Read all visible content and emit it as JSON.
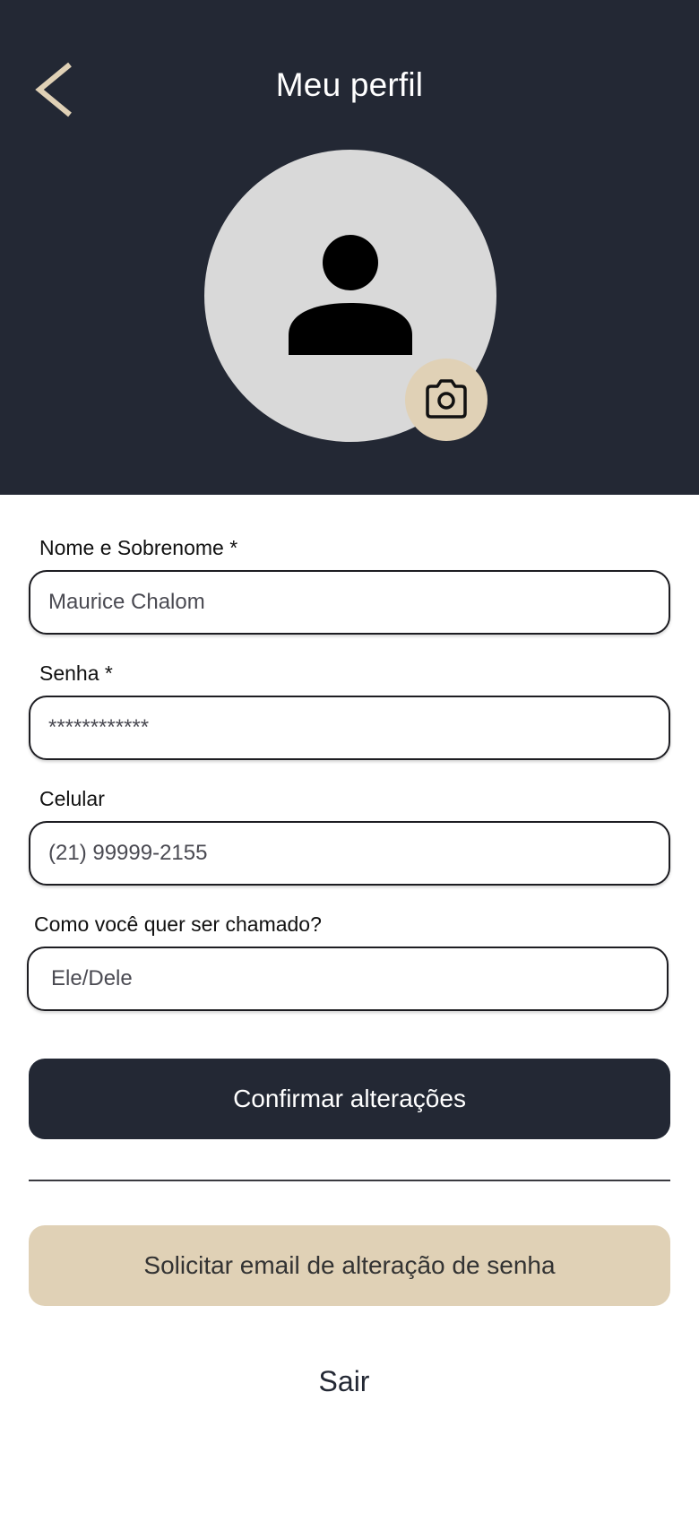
{
  "header": {
    "title": "Meu perfil",
    "back_icon": "chevron-left-icon",
    "background_color": "#232834",
    "accent_color": "#e0d1b6"
  },
  "avatar": {
    "icon": "person-icon",
    "edit_icon": "camera-icon"
  },
  "form": {
    "fields": [
      {
        "label": "Nome e Sobrenome *",
        "value": "Maurice Chalom",
        "type": "text"
      },
      {
        "label": "Senha *",
        "value": "************",
        "type": "text"
      },
      {
        "label": "Celular",
        "value": "(21) 99999-2155",
        "type": "tel"
      },
      {
        "label": "Como você quer ser chamado?",
        "value": "Ele/Dele",
        "type": "text"
      }
    ]
  },
  "actions": {
    "confirm_label": "Confirmar alterações",
    "reset_password_label": "Solicitar email de alteração de senha",
    "logout_label": "Sair"
  }
}
